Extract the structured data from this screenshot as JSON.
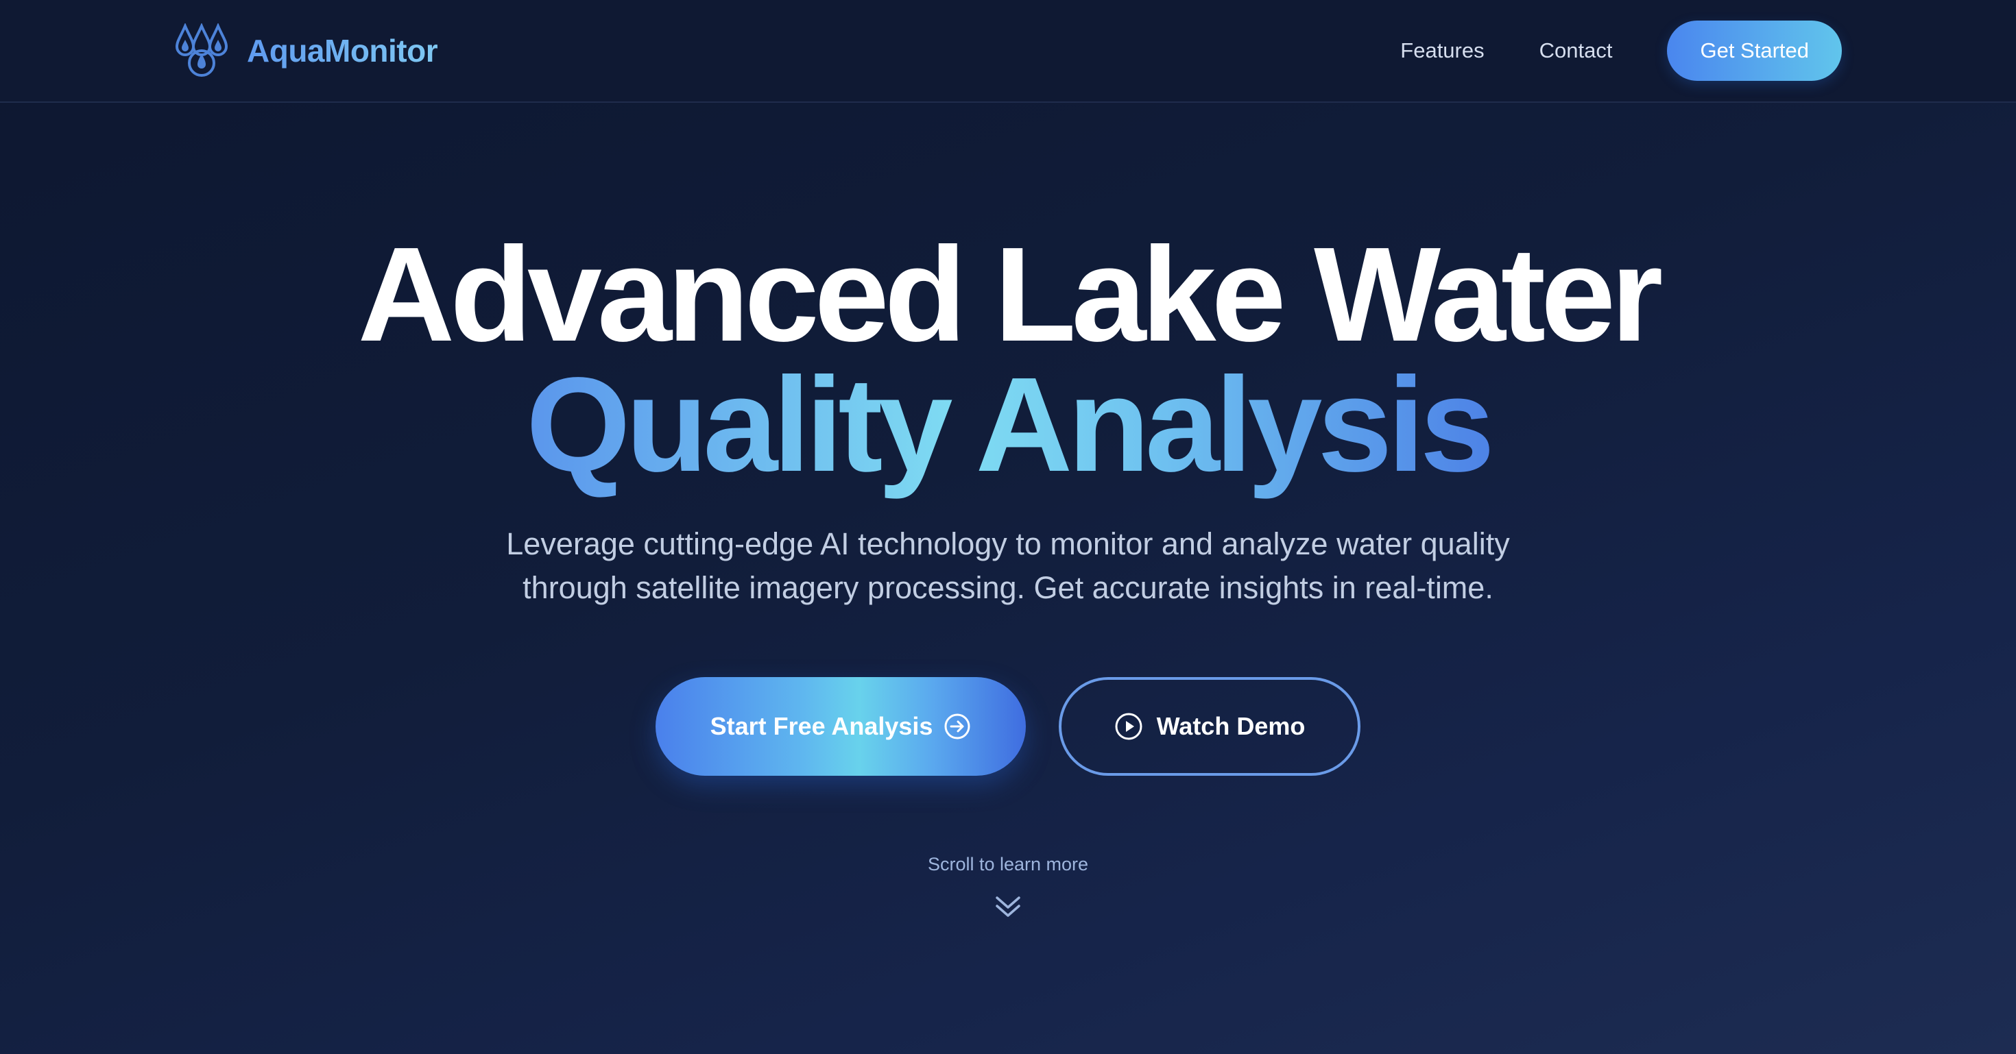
{
  "brand": {
    "name": "AquaMonitor",
    "icon": "water-drops-icon"
  },
  "nav": {
    "links": [
      {
        "label": "Features"
      },
      {
        "label": "Contact"
      }
    ],
    "cta_label": "Get Started"
  },
  "hero": {
    "title_line1": "Advanced Lake Water",
    "title_line2": "Quality Analysis",
    "subtitle_line1": "Leverage cutting-edge AI technology to monitor and analyze water quality",
    "subtitle_line2": "through satellite imagery processing. Get accurate insights in real-time.",
    "primary_button": {
      "label": "Start Free Analysis",
      "icon": "arrow-right-circle-icon"
    },
    "secondary_button": {
      "label": "Watch Demo",
      "icon": "play-circle-icon"
    },
    "scroll_hint": "Scroll to learn more",
    "scroll_icon": "double-chevron-down-icon"
  },
  "colors": {
    "background": "#111d3a",
    "navbar": "#0f1933",
    "accent_blue": "#4a86ee",
    "accent_cyan": "#68d2ec",
    "outline_border": "#6a9be8"
  }
}
